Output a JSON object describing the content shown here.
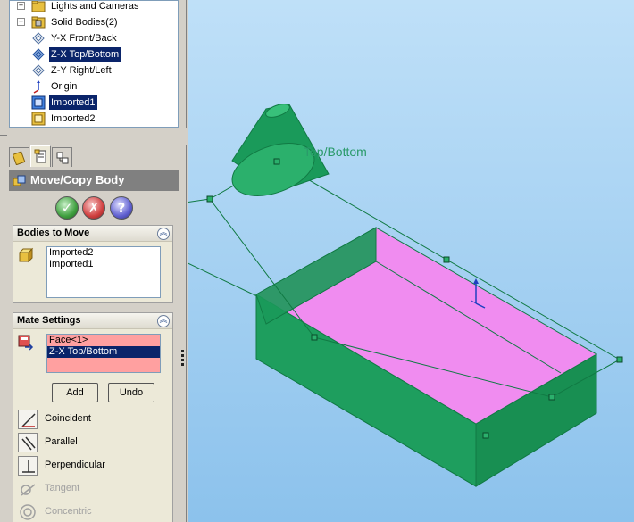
{
  "feature_tree": {
    "items": [
      {
        "label": "Lights and Cameras",
        "icon": "folder-icon",
        "expandable": true,
        "selected": false
      },
      {
        "label": "Solid Bodies(2)",
        "icon": "folder-icon",
        "expandable": true,
        "selected": false
      },
      {
        "label": "Y-X Front/Back",
        "icon": "plane-icon",
        "expandable": false,
        "selected": false
      },
      {
        "label": "Z-X Top/Bottom",
        "icon": "plane-icon",
        "expandable": false,
        "selected": true
      },
      {
        "label": "Z-Y Right/Left",
        "icon": "plane-icon",
        "expandable": false,
        "selected": false
      },
      {
        "label": "Origin",
        "icon": "origin-icon",
        "expandable": false,
        "selected": false
      },
      {
        "label": "Imported1",
        "icon": "imported-part-icon",
        "expandable": false,
        "selected": true
      },
      {
        "label": "Imported2",
        "icon": "imported-part-icon",
        "expandable": false,
        "selected": false
      }
    ]
  },
  "tabs": [
    {
      "name": "feature-manager-tab",
      "icon": "feature-manager-icon"
    },
    {
      "name": "property-manager-tab",
      "icon": "property-manager-icon",
      "active": true
    },
    {
      "name": "configuration-manager-tab",
      "icon": "configuration-manager-icon"
    }
  ],
  "property_manager": {
    "title": "Move/Copy Body",
    "ok_symbol": "✓",
    "cancel_symbol": "✗",
    "help_symbol": "?"
  },
  "bodies_to_move": {
    "title": "Bodies to Move",
    "items": [
      "Imported2",
      "Imported1"
    ]
  },
  "mate_settings": {
    "title": "Mate Settings",
    "selections": [
      "Face<1>",
      "Z-X Top/Bottom"
    ],
    "add_label": "Add",
    "undo_label": "Undo",
    "mate_types": [
      {
        "label": "Coincident",
        "enabled": true
      },
      {
        "label": "Parallel",
        "enabled": true
      },
      {
        "label": "Perpendicular",
        "enabled": true
      },
      {
        "label": "Tangent",
        "enabled": false
      },
      {
        "label": "Concentric",
        "enabled": false
      }
    ]
  },
  "viewport": {
    "plane_label": "Top/Bottom",
    "colors": {
      "body_green": "#1a9a5a",
      "face_pink": "#f08cf0",
      "edge_line": "#117a44",
      "background_top": "#bfe0f8",
      "background_bottom": "#8cc2ec"
    }
  }
}
